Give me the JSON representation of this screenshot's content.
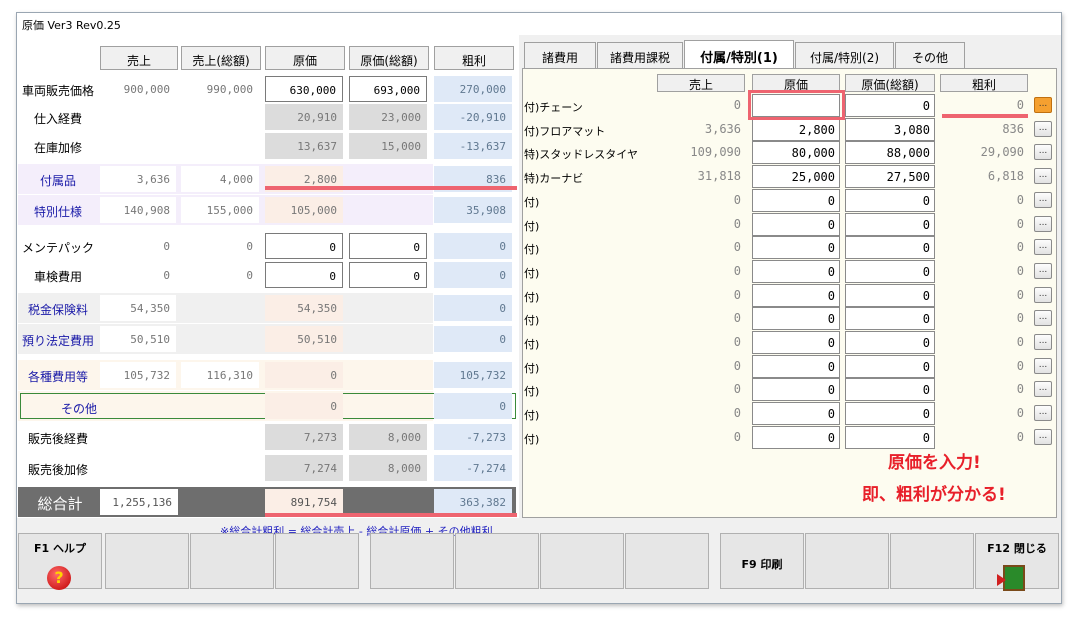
{
  "window": {
    "title": "原価 Ver3 Rev0.25"
  },
  "left": {
    "headers": [
      "売上",
      "売上(総額)",
      "原価",
      "原価(総額)",
      "粗利"
    ],
    "rows": [
      {
        "label": "車両販売価格",
        "uri": "900,000",
        "uri_total": "990,000",
        "genka": "630,000",
        "genka_total": "693,000",
        "arari": "270,000"
      },
      {
        "label": "仕入経費",
        "uri": "",
        "uri_total": "",
        "genka": "20,910",
        "genka_total": "23,000",
        "arari": "-20,910"
      },
      {
        "label": "在庫加修",
        "uri": "",
        "uri_total": "",
        "genka": "13,637",
        "genka_total": "15,000",
        "arari": "-13,637"
      },
      {
        "label": "付属品",
        "uri": "3,636",
        "uri_total": "4,000",
        "genka": "2,800",
        "genka_total": "",
        "arari": "836"
      },
      {
        "label": "特別仕様",
        "uri": "140,908",
        "uri_total": "155,000",
        "genka": "105,000",
        "genka_total": "",
        "arari": "35,908"
      },
      {
        "label": "メンテパック",
        "uri": "0",
        "uri_total": "0",
        "genka": "0",
        "genka_total": "0",
        "arari": "0"
      },
      {
        "label": "車検費用",
        "uri": "0",
        "uri_total": "0",
        "genka": "0",
        "genka_total": "0",
        "arari": "0"
      },
      {
        "label": "税金保険料",
        "uri": "54,350",
        "uri_total": "",
        "genka": "54,350",
        "genka_total": "",
        "arari": "0"
      },
      {
        "label": "預り法定費用",
        "uri": "50,510",
        "uri_total": "",
        "genka": "50,510",
        "genka_total": "",
        "arari": "0"
      },
      {
        "label": "各種費用等",
        "uri": "105,732",
        "uri_total": "116,310",
        "genka": "0",
        "genka_total": "",
        "arari": "105,732"
      },
      {
        "label": "その他",
        "uri": "",
        "uri_total": "",
        "genka": "0",
        "genka_total": "",
        "arari": "0"
      },
      {
        "label": "販売後経費",
        "uri": "",
        "uri_total": "",
        "genka": "7,273",
        "genka_total": "8,000",
        "arari": "-7,273"
      },
      {
        "label": "販売後加修",
        "uri": "",
        "uri_total": "",
        "genka": "7,274",
        "genka_total": "8,000",
        "arari": "-7,274"
      }
    ],
    "total": {
      "label": "総合計",
      "uri": "1,255,136",
      "genka": "891,754",
      "arari": "363,382"
    },
    "note": "※総合計粗利 = 総合計売上 - 総合計原価 + その他粗利"
  },
  "tabs": [
    "諸費用",
    "諸費用課税",
    "付属/特別(1)",
    "付属/特別(2)",
    "その他"
  ],
  "right": {
    "headers": [
      "売上",
      "原価",
      "原価(総額)",
      "粗利"
    ],
    "rows": [
      {
        "label": "付)チェーン",
        "uri": "0",
        "genka": "",
        "genka_total": "0",
        "arari": "0"
      },
      {
        "label": "付)フロアマット",
        "uri": "3,636",
        "genka": "2,800",
        "genka_total": "3,080",
        "arari": "836"
      },
      {
        "label": "特)スタッドレスタイヤ",
        "uri": "109,090",
        "genka": "80,000",
        "genka_total": "88,000",
        "arari": "29,090"
      },
      {
        "label": "特)カーナビ",
        "uri": "31,818",
        "genka": "25,000",
        "genka_total": "27,500",
        "arari": "6,818"
      },
      {
        "label": "付)",
        "uri": "0",
        "genka": "0",
        "genka_total": "0",
        "arari": "0"
      },
      {
        "label": "付)",
        "uri": "0",
        "genka": "0",
        "genka_total": "0",
        "arari": "0"
      },
      {
        "label": "付)",
        "uri": "0",
        "genka": "0",
        "genka_total": "0",
        "arari": "0"
      },
      {
        "label": "付)",
        "uri": "0",
        "genka": "0",
        "genka_total": "0",
        "arari": "0"
      },
      {
        "label": "付)",
        "uri": "0",
        "genka": "0",
        "genka_total": "0",
        "arari": "0"
      },
      {
        "label": "付)",
        "uri": "0",
        "genka": "0",
        "genka_total": "0",
        "arari": "0"
      },
      {
        "label": "付)",
        "uri": "0",
        "genka": "0",
        "genka_total": "0",
        "arari": "0"
      },
      {
        "label": "付)",
        "uri": "0",
        "genka": "0",
        "genka_total": "0",
        "arari": "0"
      },
      {
        "label": "付)",
        "uri": "0",
        "genka": "0",
        "genka_total": "0",
        "arari": "0"
      },
      {
        "label": "付)",
        "uri": "0",
        "genka": "0",
        "genka_total": "0",
        "arari": "0"
      },
      {
        "label": "付)",
        "uri": "0",
        "genka": "0",
        "genka_total": "0",
        "arari": "0"
      }
    ],
    "dots_label": "..."
  },
  "annotation": {
    "line1": "原価を入力!",
    "line2": "即、粗利が分かる!"
  },
  "fkeys": {
    "f1": "F1 ヘルプ",
    "f9": "F9 印刷",
    "f12": "F12 閉じる"
  },
  "colors": {
    "accent_red": "#ee6470",
    "annotation_red": "#e8202a",
    "label_blue": "#1a1aa8"
  }
}
